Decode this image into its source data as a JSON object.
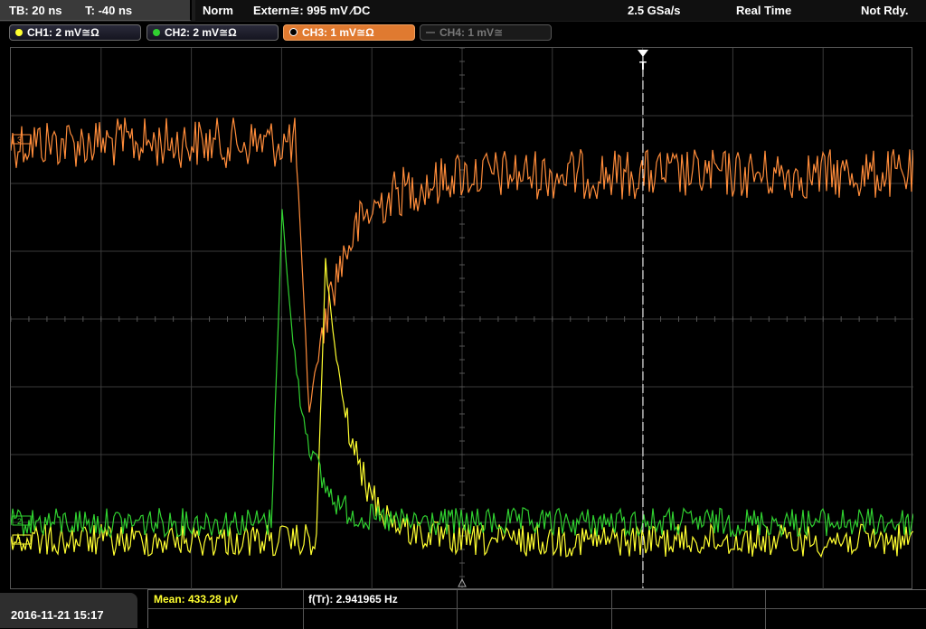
{
  "timebase": {
    "tb": "TB: 20 ns",
    "t": "T: -40 ns"
  },
  "status": {
    "mode": "Norm",
    "trigger": "Extern≅: 995 mV ⁄DC",
    "sample_rate": "2.5 GSa/s",
    "acq": "Real Time",
    "state": "Not Rdy."
  },
  "channels": [
    {
      "label": "CH1: 2 mV≅Ω",
      "color": "#ffff30",
      "state": "on"
    },
    {
      "label": "CH2: 2 mV≅Ω",
      "color": "#30d030",
      "state": "on"
    },
    {
      "label": "CH3: 1 mV≅Ω",
      "color": "#ff8c3a",
      "state": "active"
    },
    {
      "label": "CH4: 1 mV≅",
      "color": "#777777",
      "state": "off"
    }
  ],
  "markers": {
    "ch3_marker": "3",
    "ch2_marker": "2",
    "ch1_marker": "1",
    "trigger_marker": "T"
  },
  "bottom": {
    "datetime": "2016-11-21 15:17",
    "mean_label": "Mean: 433.28 µV",
    "freq_label": "f(Tr): 2.941965 Hz"
  },
  "colors": {
    "ch1": "#ffff30",
    "ch2": "#30d030",
    "ch3": "#ff8c3a",
    "grid": "#3a3a3a",
    "trigger_line": "#ffffff"
  },
  "icons": {
    "trigger_position": "down-triangle-icon",
    "ground_marker": "up-triangle-icon"
  }
}
